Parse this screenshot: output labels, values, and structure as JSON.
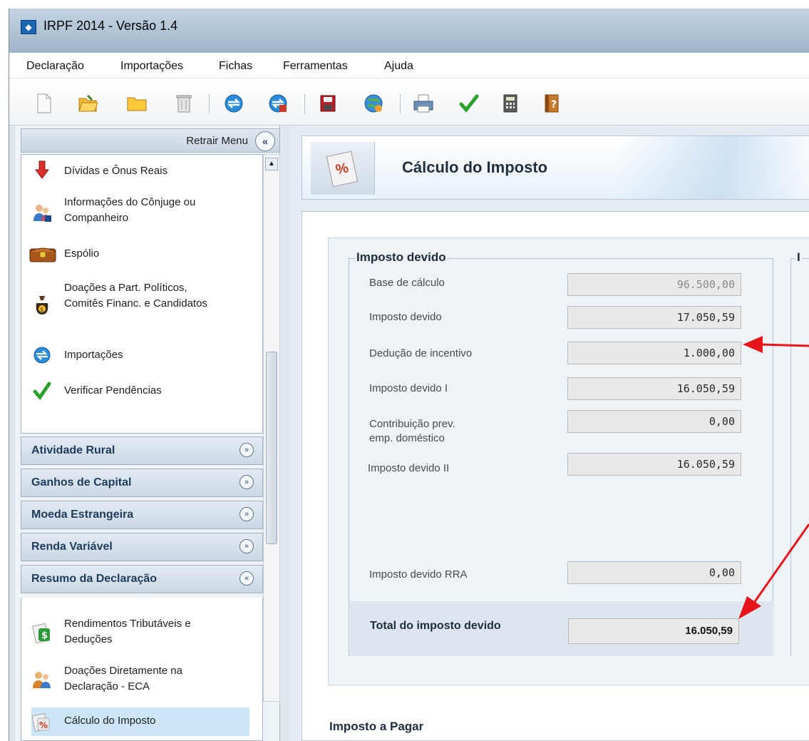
{
  "window": {
    "title": "IRPF 2014 - Versão 1.4"
  },
  "menubar": {
    "items": [
      "Declaração",
      "Importações",
      "Fichas",
      "Ferramentas",
      "Ajuda"
    ]
  },
  "toolbar": {
    "buttons": [
      "new-file-icon",
      "open-folder-icon",
      "folder-icon",
      "trash-icon",
      "import-icon",
      "transmit-icon",
      "save-icon",
      "globe-icon",
      "print-icon",
      "check-icon",
      "calculator-icon",
      "help-book-icon"
    ]
  },
  "sidebar": {
    "retrair_label": "Retrair Menu",
    "retrair_button": "«",
    "items": [
      {
        "label": "Dívidas e Ônus Reais",
        "icon": "debt-arrow-icon"
      },
      {
        "label": "Informações do Cônjuge ou Companheiro",
        "icon": "spouse-icon"
      },
      {
        "label": "Espólio",
        "icon": "chest-icon"
      },
      {
        "label": "Doações a Part. Políticos, Comitês Financ. e Candidatos",
        "icon": "donation-bag-icon"
      },
      {
        "label": "Importações",
        "icon": "import-icon"
      },
      {
        "label": "Verificar Pendências",
        "icon": "check-icon"
      }
    ],
    "sections": [
      {
        "label": "Atividade Rural",
        "chevron": "»"
      },
      {
        "label": "Ganhos de Capital",
        "chevron": "»"
      },
      {
        "label": "Moeda Estrangeira",
        "chevron": "»"
      },
      {
        "label": "Renda Variável",
        "chevron": "»"
      },
      {
        "label": "Resumo da Declaração",
        "chevron": "«"
      }
    ],
    "summary_items": [
      {
        "label": "Rendimentos Tributáveis e Deduções",
        "icon": "money-card-icon"
      },
      {
        "label": "Doações Diretamente na Declaração - ECA",
        "icon": "people-icon"
      },
      {
        "label": "Cálculo do Imposto",
        "icon": "percent-card-icon",
        "selected": true
      }
    ]
  },
  "main": {
    "page_title": "Cálculo do Imposto",
    "banner_icon_text": "%",
    "group_title": "Imposto devido",
    "group2_title": "I",
    "rows": [
      {
        "label": "Base de cálculo",
        "value": "96.500,00"
      },
      {
        "label": "Imposto devido",
        "value": "17.050,59"
      },
      {
        "label": "Dedução de incentivo",
        "value": "1.000,00"
      },
      {
        "label": "Imposto devido I",
        "value": "16.050,59"
      },
      {
        "label": "Contribuição prev.\nemp. doméstico",
        "value": "0,00"
      },
      {
        "label": "Imposto devido II",
        "value": "16.050,59"
      },
      {
        "label": "Imposto devido RRA",
        "value": "0,00"
      }
    ],
    "total": {
      "label": "Total do imposto devido",
      "value": "16.050,59"
    },
    "next_section_title": "Imposto a Pagar"
  },
  "colors": {
    "annotation_arrow": "#e8141b",
    "selected_item": "#cde6f7",
    "section_text": "#1d3c5c"
  }
}
